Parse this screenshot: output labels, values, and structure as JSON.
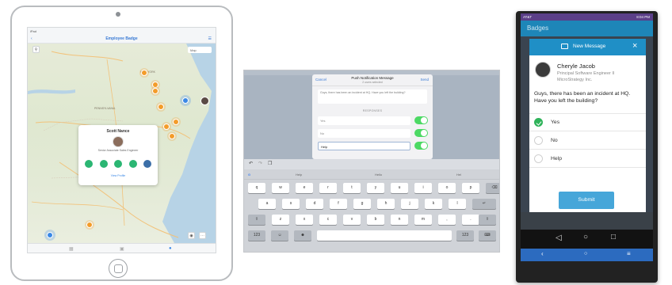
{
  "ipad_app": {
    "title": "Employee Badge",
    "status_left": "iPad",
    "popup": {
      "name": "Scott Nance",
      "role": "Senior Associate Sales Engineer",
      "more_label": "View Profile"
    },
    "map_labels": [
      "PENNSYLVANIA",
      "NEW YORK",
      "VIRGINIA",
      "Ohio",
      "New York",
      "Raleigh"
    ]
  },
  "push_sheet": {
    "cancel_label": "Cancel",
    "send_label": "Send",
    "title": "Push Notification Message",
    "subtitle": "2 users selected",
    "message": "Guys, there has been an incident at HQ. Have you left the building?",
    "responses_header": "RESPONSES",
    "options": [
      "Yes",
      "No",
      "Help"
    ],
    "keyboard": {
      "suggestions": [
        "Help",
        "Hello",
        "Hel"
      ],
      "row1": [
        "q",
        "w",
        "e",
        "r",
        "t",
        "y",
        "u",
        "i",
        "o",
        "p"
      ],
      "row2": [
        "a",
        "s",
        "d",
        "f",
        "g",
        "h",
        "j",
        "k",
        "l"
      ],
      "row3": [
        "z",
        "x",
        "c",
        "v",
        "b",
        "n",
        "m",
        ",",
        "."
      ],
      "left_key": "123",
      "right_key": "123"
    }
  },
  "android": {
    "status_left": "AT&T",
    "status_right": "8:04 PM",
    "app_title": "Badges",
    "dialog_title": "New Message",
    "sender_name": "Cheryle Jacob",
    "sender_title": "Principal Software Engineer II",
    "sender_company": "MicroStrategy Inc.",
    "question": "Guys, there has been an incident at HQ. Have you left the building?",
    "options": [
      {
        "label": "Yes",
        "selected": true
      },
      {
        "label": "No",
        "selected": false
      },
      {
        "label": "Help",
        "selected": false
      }
    ],
    "submit_label": "Submit",
    "colors": {
      "accent": "#1f8fc6",
      "success": "#2fb35a",
      "submit": "#46a6d9"
    }
  }
}
